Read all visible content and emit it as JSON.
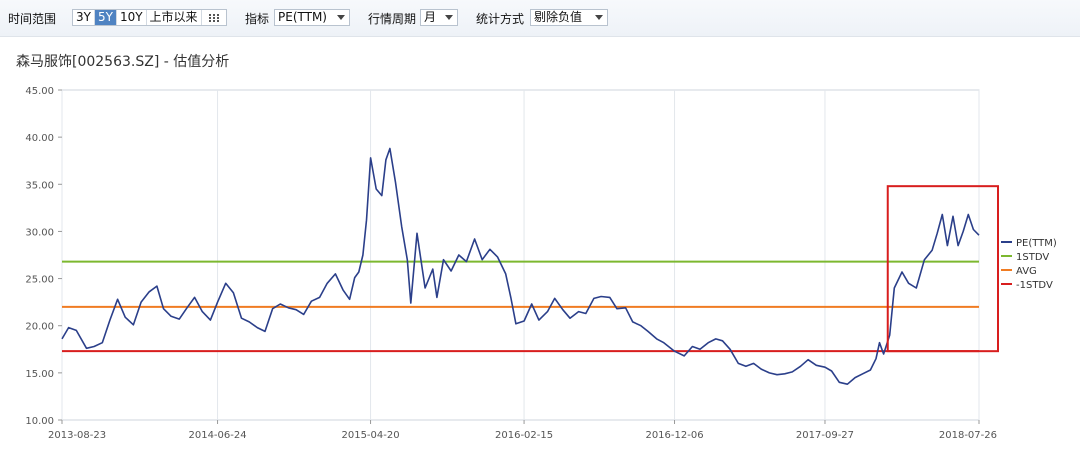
{
  "toolbar": {
    "range_label": "时间范围",
    "range_options": [
      "3Y",
      "5Y",
      "10Y",
      "上市以来"
    ],
    "range_active": "5Y",
    "metric_label": "指标",
    "metric_value": "PE(TTM)",
    "period_label": "行情周期",
    "period_value": "月",
    "stat_label": "统计方式",
    "stat_value": "剔除负值"
  },
  "chart_data": {
    "type": "line",
    "title": "森马服饰[002563.SZ] - 估值分析",
    "xlabel": "",
    "ylabel": "",
    "ylim": [
      10,
      45
    ],
    "y_ticks": [
      "10.00",
      "15.00",
      "20.00",
      "25.00",
      "30.00",
      "35.00",
      "40.00",
      "45.00"
    ],
    "x_range": [
      "2013-08-23",
      "2018-07-26"
    ],
    "x_ticks": [
      "2013-08-23",
      "2014-06-24",
      "2015-04-20",
      "2016-02-15",
      "2016-12-06",
      "2017-09-27",
      "2018-07-26"
    ],
    "grid": "vertical",
    "legend_position": "right",
    "legend": [
      "PE(TTM)",
      "1STDV",
      "AVG",
      "-1STDV"
    ],
    "colors": {
      "pe": "#2b3f8a",
      "stdv_plus": "#7cb82f",
      "avg": "#f07c22",
      "stdv_minus": "#d81e1e",
      "highlight": "#d81e1e"
    },
    "reference_lines": [
      {
        "name": "1STDV",
        "value": 26.8
      },
      {
        "name": "AVG",
        "value": 22.0
      },
      {
        "name": "-1STDV",
        "value": 17.3
      }
    ],
    "highlight_box": {
      "x": [
        "2018-02-01",
        "2018-07-26"
      ],
      "y": [
        17.3,
        34.8
      ]
    },
    "series": [
      {
        "name": "PE(TTM)",
        "x": [
          "2013-08-23",
          "2013-09-05",
          "2013-09-20",
          "2013-10-10",
          "2013-10-25",
          "2013-11-10",
          "2013-11-25",
          "2013-12-10",
          "2013-12-25",
          "2014-01-10",
          "2014-01-25",
          "2014-02-10",
          "2014-02-25",
          "2014-03-10",
          "2014-03-25",
          "2014-04-10",
          "2014-04-25",
          "2014-05-10",
          "2014-05-25",
          "2014-06-10",
          "2014-06-24",
          "2014-07-10",
          "2014-07-25",
          "2014-08-10",
          "2014-08-25",
          "2014-09-10",
          "2014-09-25",
          "2014-10-10",
          "2014-10-25",
          "2014-11-10",
          "2014-11-25",
          "2014-12-10",
          "2014-12-25",
          "2015-01-10",
          "2015-01-25",
          "2015-02-10",
          "2015-02-25",
          "2015-03-10",
          "2015-03-20",
          "2015-03-28",
          "2015-04-05",
          "2015-04-12",
          "2015-04-20",
          "2015-05-01",
          "2015-05-12",
          "2015-05-20",
          "2015-05-28",
          "2015-06-08",
          "2015-06-20",
          "2015-07-01",
          "2015-07-08",
          "2015-07-20",
          "2015-08-05",
          "2015-08-20",
          "2015-08-28",
          "2015-09-10",
          "2015-09-25",
          "2015-10-10",
          "2015-10-25",
          "2015-11-10",
          "2015-11-25",
          "2015-12-10",
          "2015-12-25",
          "2016-01-10",
          "2016-01-20",
          "2016-01-30",
          "2016-02-15",
          "2016-03-01",
          "2016-03-15",
          "2016-04-01",
          "2016-04-15",
          "2016-05-01",
          "2016-05-15",
          "2016-06-01",
          "2016-06-15",
          "2016-07-01",
          "2016-07-15",
          "2016-08-01",
          "2016-08-15",
          "2016-09-01",
          "2016-09-15",
          "2016-10-01",
          "2016-10-15",
          "2016-11-01",
          "2016-11-15",
          "2016-12-06",
          "2016-12-25",
          "2017-01-10",
          "2017-01-25",
          "2017-02-10",
          "2017-02-25",
          "2017-03-10",
          "2017-03-25",
          "2017-04-10",
          "2017-04-25",
          "2017-05-10",
          "2017-05-25",
          "2017-06-10",
          "2017-06-25",
          "2017-07-10",
          "2017-07-25",
          "2017-08-10",
          "2017-08-25",
          "2017-09-10",
          "2017-09-27",
          "2017-10-10",
          "2017-10-25",
          "2017-11-10",
          "2017-11-25",
          "2017-12-10",
          "2017-12-25",
          "2018-01-05",
          "2018-01-12",
          "2018-01-20",
          "2018-02-01",
          "2018-02-10",
          "2018-02-25",
          "2018-03-10",
          "2018-03-25",
          "2018-04-10",
          "2018-04-25",
          "2018-05-05",
          "2018-05-15",
          "2018-05-25",
          "2018-06-05",
          "2018-06-15",
          "2018-06-25",
          "2018-07-05",
          "2018-07-15",
          "2018-07-26"
        ],
        "values": [
          18.6,
          19.8,
          19.5,
          17.6,
          17.8,
          18.2,
          20.6,
          22.8,
          20.9,
          20.1,
          22.5,
          23.6,
          24.2,
          21.8,
          21.0,
          20.7,
          21.9,
          23.0,
          21.5,
          20.6,
          22.5,
          24.5,
          23.5,
          20.8,
          20.4,
          19.8,
          19.4,
          21.8,
          22.3,
          21.9,
          21.7,
          21.2,
          22.6,
          23.0,
          24.5,
          25.5,
          23.8,
          22.8,
          25.1,
          25.7,
          27.5,
          31.2,
          37.8,
          34.5,
          33.8,
          37.6,
          38.8,
          35.2,
          30.5,
          27.0,
          22.4,
          29.8,
          24.0,
          26.0,
          23.0,
          27.0,
          25.8,
          27.5,
          26.8,
          29.2,
          27.0,
          28.1,
          27.3,
          25.5,
          23.0,
          20.2,
          20.5,
          22.3,
          20.6,
          21.5,
          22.9,
          21.7,
          20.8,
          21.5,
          21.3,
          22.9,
          23.1,
          23.0,
          21.8,
          21.9,
          20.4,
          20.0,
          19.4,
          18.6,
          18.2,
          17.3,
          16.8,
          17.8,
          17.5,
          18.2,
          18.6,
          18.4,
          17.5,
          16.0,
          15.7,
          16.0,
          15.4,
          15.0,
          14.8,
          14.9,
          15.1,
          15.7,
          16.4,
          15.8,
          15.6,
          15.2,
          14.0,
          13.8,
          14.5,
          14.9,
          15.3,
          16.5,
          18.2,
          17.0,
          19.0,
          24.0,
          25.7,
          24.5,
          24.0,
          27.0,
          28.0,
          29.8,
          31.8,
          28.5,
          31.6,
          28.5,
          30.0,
          31.8,
          30.2,
          29.6
        ]
      }
    ]
  }
}
